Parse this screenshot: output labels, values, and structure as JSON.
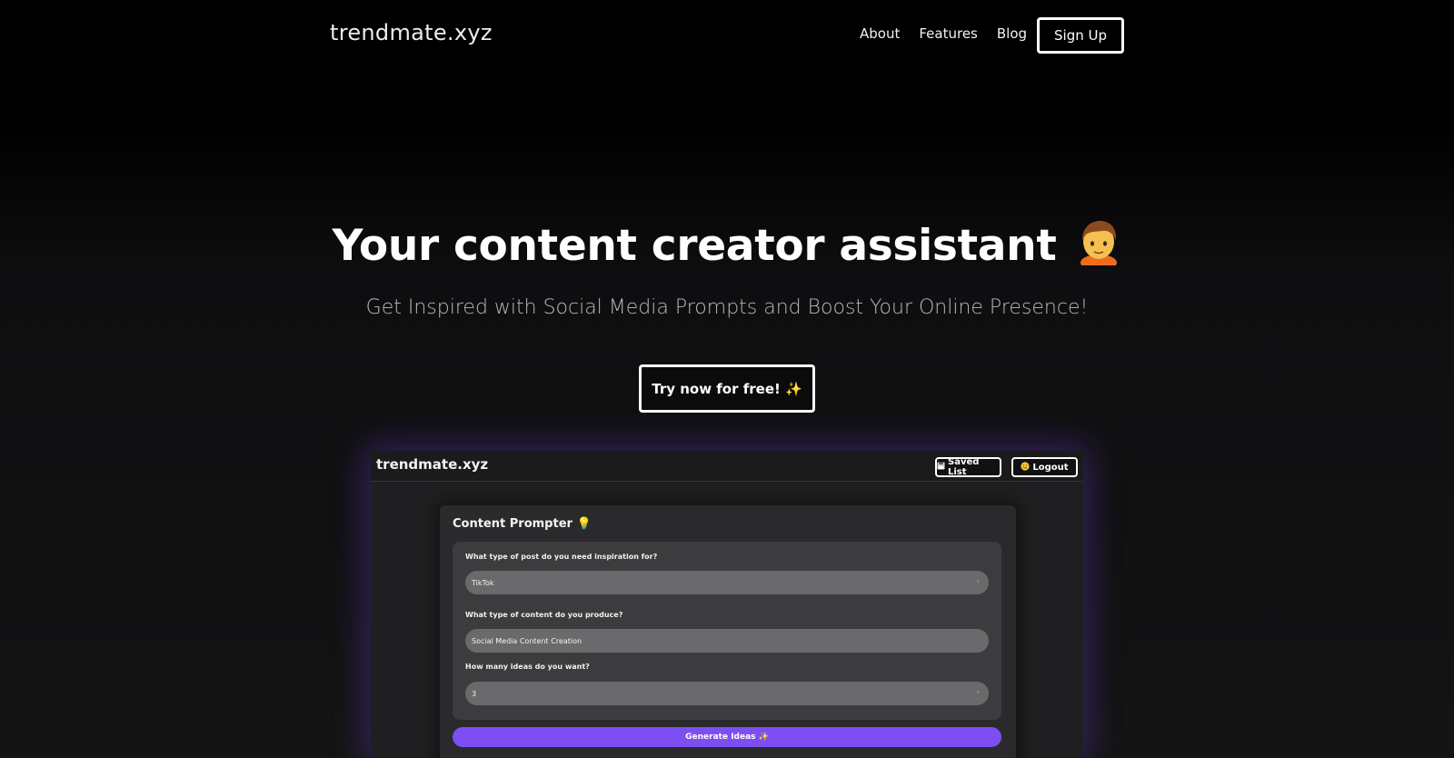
{
  "nav": {
    "logo": "trendmate.xyz",
    "links": [
      "About",
      "Features",
      "Blog"
    ],
    "signup_label": "Sign Up"
  },
  "hero": {
    "title": "Your content creator assistant",
    "title_icon": "person-emoji",
    "subtitle": "Get Inspired with Social Media Prompts and Boost Your Online Presence!",
    "cta_label": "Try now for free! ✨"
  },
  "app_preview": {
    "logo": "trendmate.xyz",
    "saved_list_label": "Saved List",
    "saved_list_icon": "floppy-disk-icon",
    "logout_label": "Logout",
    "logout_icon": "smiley-face-icon",
    "card_title": "Content Prompter 💡",
    "questions": [
      {
        "label": "What type of post do you need inspiration for?",
        "value": "TikTok"
      },
      {
        "label": "What type of content do you produce?",
        "value": "Social Media Content Creation"
      },
      {
        "label": "How many ideas do you want?",
        "value": "3"
      }
    ],
    "generate_label": "Generate Ideas ✨"
  },
  "colors": {
    "background": "#000000",
    "accent_purple": "#7d4ff2",
    "glow": "#7846e6"
  }
}
